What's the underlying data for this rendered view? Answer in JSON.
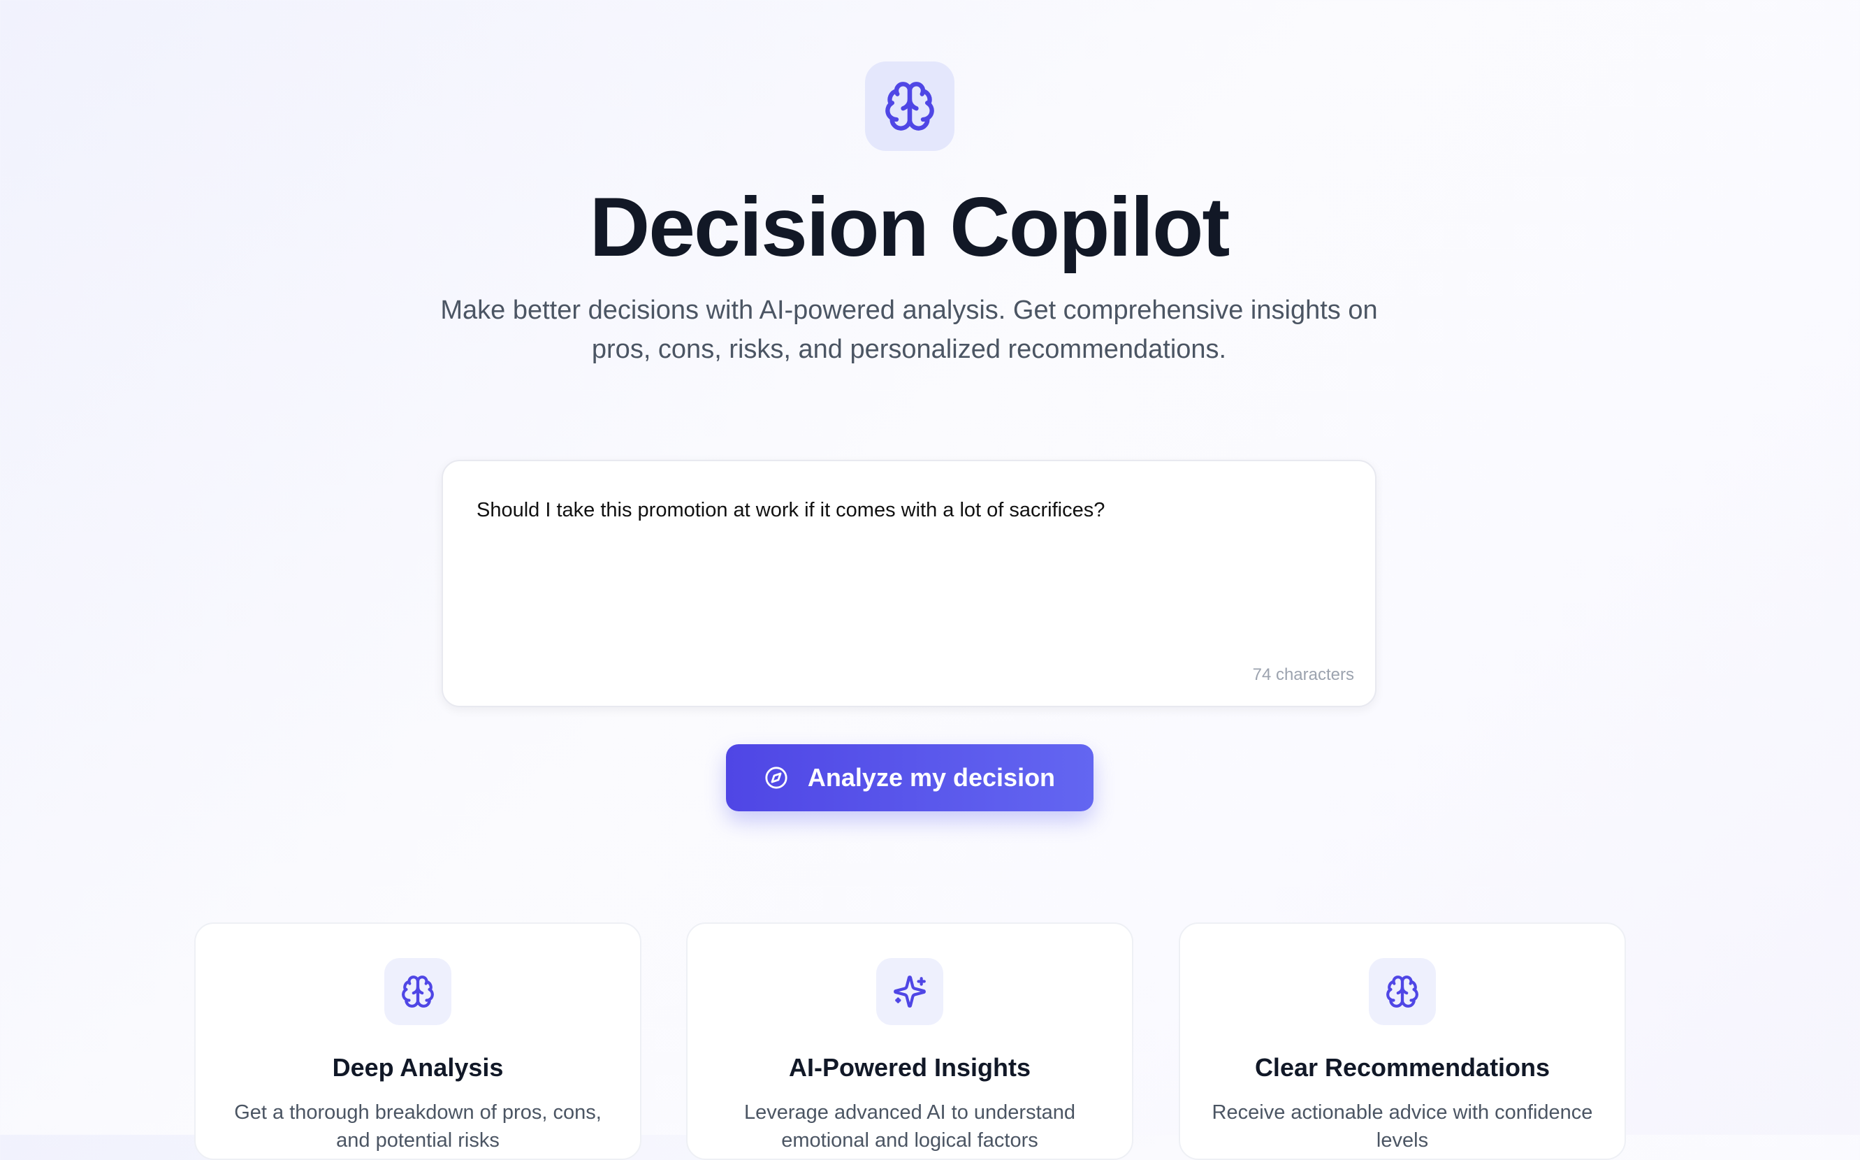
{
  "header": {
    "icon": "brain-icon",
    "title": "Decision Copilot",
    "subtitle": "Make better decisions with AI-powered analysis. Get comprehensive insights on pros, cons, risks, and personalized recommendations."
  },
  "input": {
    "value": "Should I take this promotion at work if it comes with a lot of sacrifices?",
    "char_count": "74 characters"
  },
  "action": {
    "label": "Analyze my decision",
    "icon": "compass-icon"
  },
  "features": [
    {
      "icon": "brain-icon",
      "title": "Deep Analysis",
      "description": "Get a thorough breakdown of pros, cons, and potential risks"
    },
    {
      "icon": "sparkles-icon",
      "title": "AI-Powered Insights",
      "description": "Leverage advanced AI to understand emotional and logical factors"
    },
    {
      "icon": "brain-icon",
      "title": "Clear Recommendations",
      "description": "Receive actionable advice with confidence levels"
    }
  ],
  "colors": {
    "accent": "#4f46e5",
    "accent_light": "#6366f1",
    "icon_tile": "#e4e7fc",
    "title": "#121826",
    "muted_text": "#4b5563",
    "counter_text": "#9ca3af"
  }
}
